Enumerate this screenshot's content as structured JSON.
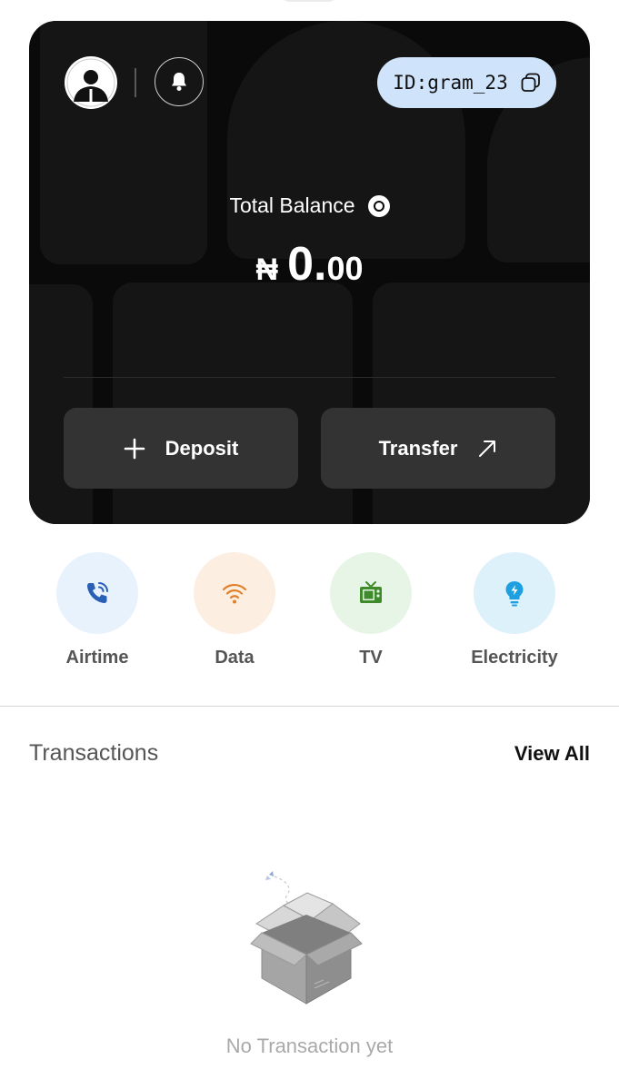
{
  "card": {
    "user_id": "ID:gram_23",
    "balance_label": "Total Balance",
    "currency_symbol": "₦",
    "balance_integer": "0.",
    "balance_decimal": "00",
    "deposit_label": "Deposit",
    "transfer_label": "Transfer"
  },
  "services": [
    {
      "label": "Airtime",
      "icon": "phone-call-icon",
      "bg": "#e8f2fd",
      "color": "#2a5fb6"
    },
    {
      "label": "Data",
      "icon": "wifi-icon",
      "bg": "#fdeee2",
      "color": "#e0812a"
    },
    {
      "label": "TV",
      "icon": "tv-icon",
      "bg": "#e6f5e6",
      "color": "#3f8b2c"
    },
    {
      "label": "Electricity",
      "icon": "bulb-icon",
      "bg": "#ddf1fb",
      "color": "#1ea0e0"
    }
  ],
  "transactions": {
    "title": "Transactions",
    "view_all_label": "View All",
    "empty_text": "No Transaction yet"
  },
  "colors": {
    "card_bg": "#0a0a0a",
    "button_bg": "#333333",
    "id_pill_bg": "#cfe3fa"
  }
}
